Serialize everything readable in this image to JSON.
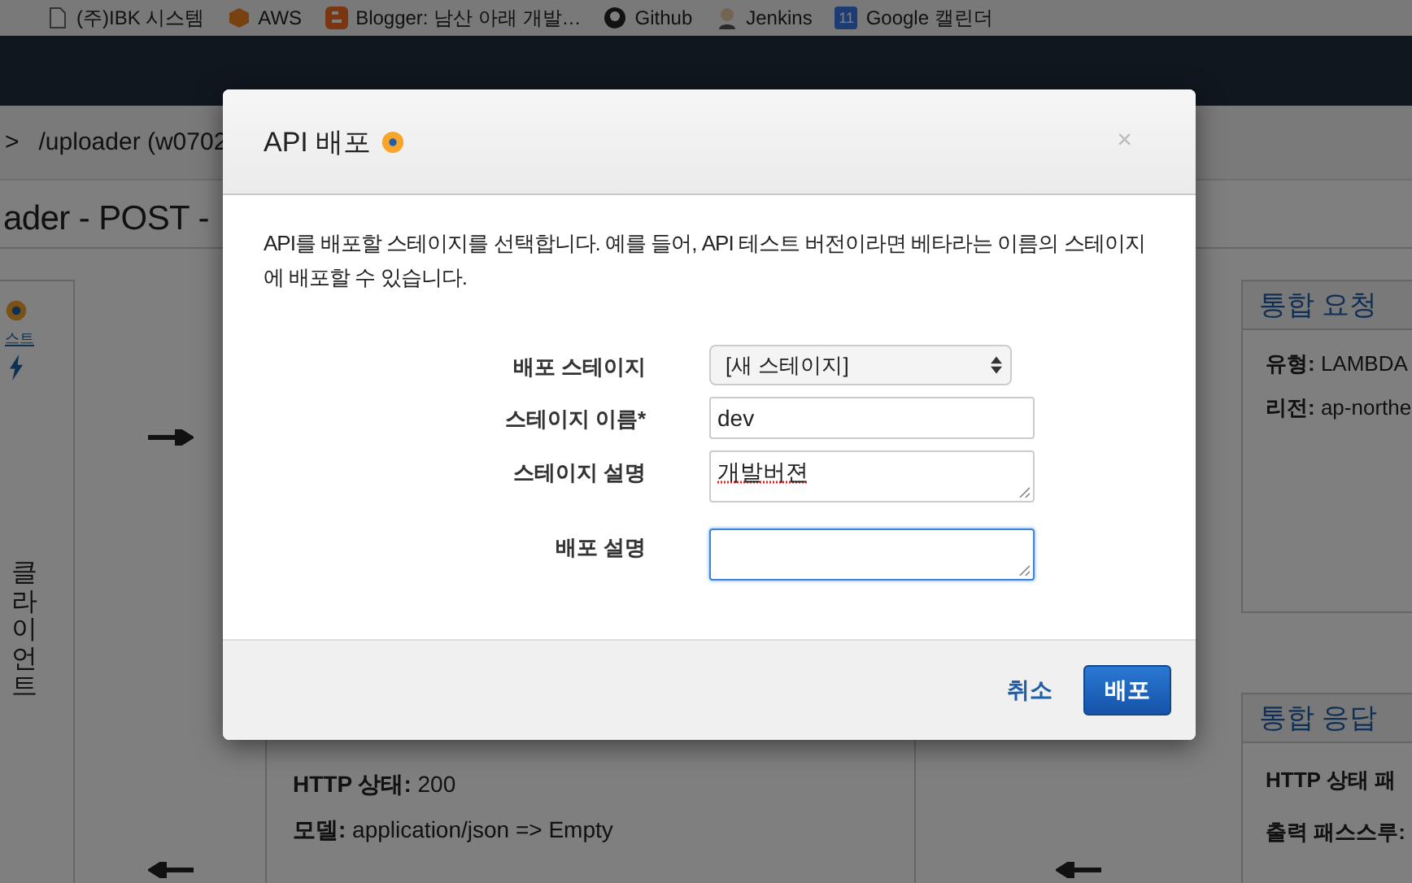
{
  "bookmarks": [
    {
      "kind": "page",
      "label": "(주)IBK 시스템"
    },
    {
      "kind": "aws",
      "label": "AWS"
    },
    {
      "kind": "blogger",
      "label": "Blogger: 남산 아래 개발…"
    },
    {
      "kind": "github",
      "label": "Github"
    },
    {
      "kind": "jenkins",
      "label": "Jenkins"
    },
    {
      "kind": "calendar",
      "label": "Google 캘린더",
      "icon_text": "11"
    }
  ],
  "breadcrumb": {
    "separator": ">",
    "path": "/uploader (w0702"
  },
  "page_title": "ader - POST -",
  "client_panel": {
    "link": "스트",
    "label": "클라이언트"
  },
  "method_response": {
    "lines": [
      {
        "key": "HTTP 상태:",
        "value": "200"
      },
      {
        "key": "모델:",
        "value": "application/json => Empty"
      }
    ]
  },
  "integration_request": {
    "title": "통합 요청",
    "lines": [
      {
        "key": "유형:",
        "value": "LAMBDA"
      },
      {
        "key": "리전:",
        "value": "ap-northe"
      }
    ]
  },
  "integration_response": {
    "title": "통합 응답",
    "lines": [
      {
        "key": "HTTP 상태 패"
      },
      {
        "key": "출력 패스스루:"
      }
    ]
  },
  "dialog": {
    "title": "API 배포",
    "close": "×",
    "description": "API를 배포할 스테이지를 선택합니다. 예를 들어, API 테스트 버전이라면 베타라는 이름의 스테이지에 배포할 수 있습니다.",
    "fields": [
      {
        "kind": "select",
        "label": "배포 스테이지",
        "value": "[새 스테이지]",
        "focused": false
      },
      {
        "kind": "input",
        "label": "스테이지 이름*",
        "value": "dev",
        "focused": false
      },
      {
        "kind": "textarea",
        "label": "스테이지 설명",
        "value": "개발버젼",
        "spellcheck_error": true,
        "focused": false
      },
      {
        "kind": "textarea",
        "label": "배포 설명",
        "focused": true
      }
    ],
    "cancel": "취소",
    "submit": "배포"
  }
}
